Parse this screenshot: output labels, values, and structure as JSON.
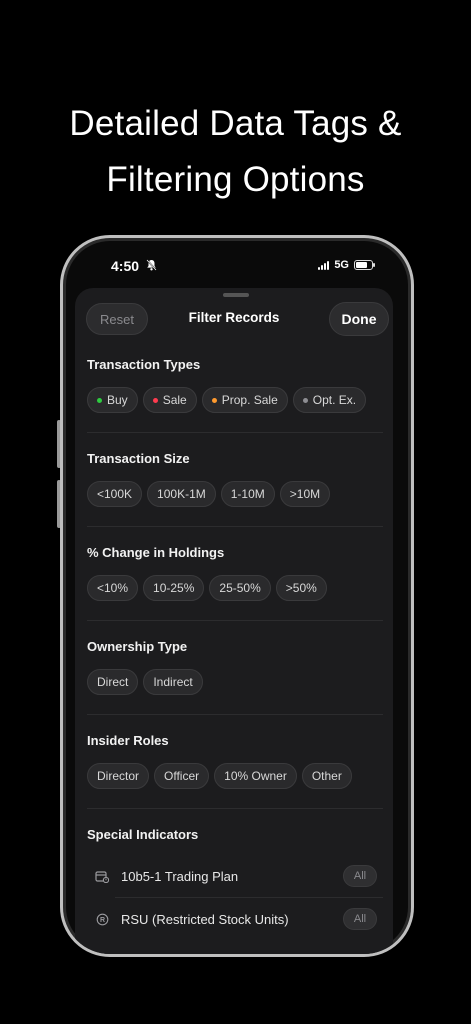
{
  "headline": {
    "line1": "Detailed Data Tags &",
    "line2": "Filtering Options"
  },
  "status_bar": {
    "time": "4:50",
    "network": "5G"
  },
  "sheet": {
    "reset_label": "Reset",
    "title": "Filter Records",
    "done_label": "Done"
  },
  "sections": {
    "transaction_types": {
      "title": "Transaction Types",
      "chips": [
        {
          "label": "Buy",
          "color": "#2ecc40"
        },
        {
          "label": "Sale",
          "color": "#ff3b4f"
        },
        {
          "label": "Prop. Sale",
          "color": "#ff9a2e"
        },
        {
          "label": "Opt. Ex.",
          "color": "#8e8e93"
        }
      ]
    },
    "transaction_size": {
      "title": "Transaction Size",
      "chips": [
        "<100K",
        "100K-1M",
        "1-10M",
        ">10M"
      ]
    },
    "pct_change": {
      "title": "% Change in Holdings",
      "chips": [
        "<10%",
        "10-25%",
        "25-50%",
        ">50%"
      ]
    },
    "ownership_type": {
      "title": "Ownership Type",
      "chips": [
        "Direct",
        "Indirect"
      ]
    },
    "insider_roles": {
      "title": "Insider Roles",
      "chips": [
        "Director",
        "Officer",
        "10% Owner",
        "Other"
      ]
    },
    "special_indicators": {
      "title": "Special Indicators",
      "rows": [
        {
          "label": "10b5-1 Trading Plan",
          "icon": "calendar-plan-icon",
          "badge": "All"
        },
        {
          "label": "RSU (Restricted Stock Units)",
          "icon": "registered-icon",
          "badge": "All"
        }
      ]
    }
  }
}
